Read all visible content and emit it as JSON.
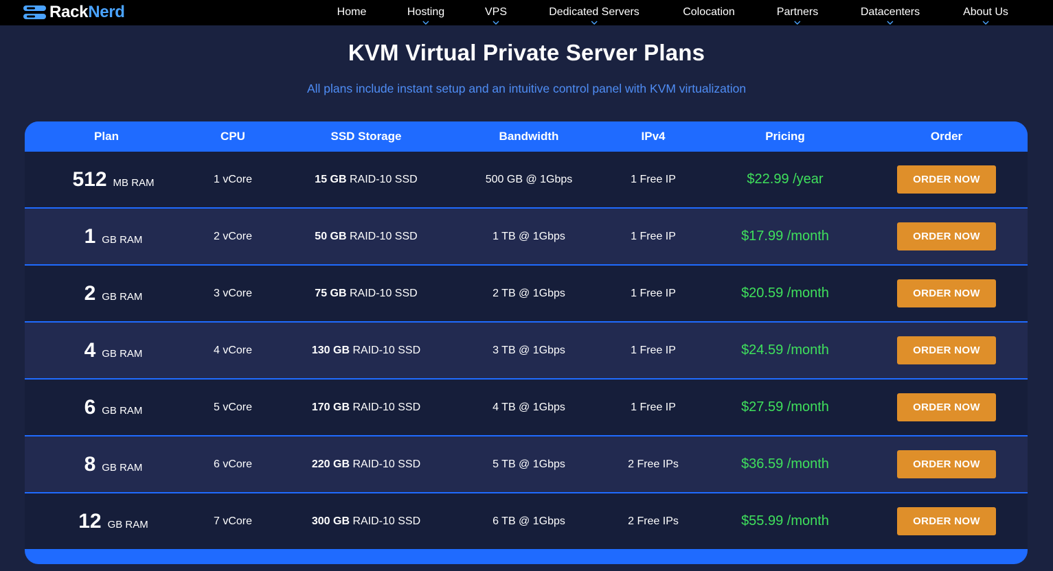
{
  "brand": {
    "name_part1": "Rack",
    "name_part2": "Nerd",
    "logo_icon": "server-stack-icon",
    "accent_color": "#4aa3ff"
  },
  "nav": {
    "items": [
      {
        "label": "Home",
        "has_dropdown": false
      },
      {
        "label": "Hosting",
        "has_dropdown": true
      },
      {
        "label": "VPS",
        "has_dropdown": true
      },
      {
        "label": "Dedicated Servers",
        "has_dropdown": true
      },
      {
        "label": "Colocation",
        "has_dropdown": false
      },
      {
        "label": "Partners",
        "has_dropdown": true
      },
      {
        "label": "Datacenters",
        "has_dropdown": true
      },
      {
        "label": "About Us",
        "has_dropdown": true
      }
    ],
    "dropdown_icon": "chevron-down-icon"
  },
  "section": {
    "title": "KVM Virtual Private Server Plans",
    "subtitle": "All plans include instant setup and an intuitive control panel with KVM virtualization"
  },
  "table": {
    "headers": [
      "Plan",
      "CPU",
      "SSD Storage",
      "Bandwidth",
      "IPv4",
      "Pricing",
      "Order"
    ],
    "rows": [
      {
        "plan_num": "512",
        "plan_unit": "MB RAM",
        "cpu": "1 vCore",
        "storage_size": "15 GB",
        "storage_type": "RAID-10 SSD",
        "bandwidth": "500 GB @ 1Gbps",
        "ipv4": "1 Free IP",
        "price": "$22.99 /year",
        "order": "ORDER NOW"
      },
      {
        "plan_num": "1",
        "plan_unit": "GB RAM",
        "cpu": "2 vCore",
        "storage_size": "50 GB",
        "storage_type": "RAID-10 SSD",
        "bandwidth": "1 TB @ 1Gbps",
        "ipv4": "1 Free IP",
        "price": "$17.99 /month",
        "order": "ORDER NOW"
      },
      {
        "plan_num": "2",
        "plan_unit": "GB RAM",
        "cpu": "3 vCore",
        "storage_size": "75 GB",
        "storage_type": "RAID-10 SSD",
        "bandwidth": "2 TB @ 1Gbps",
        "ipv4": "1 Free IP",
        "price": "$20.59 /month",
        "order": "ORDER NOW"
      },
      {
        "plan_num": "4",
        "plan_unit": "GB RAM",
        "cpu": "4 vCore",
        "storage_size": "130 GB",
        "storage_type": "RAID-10 SSD",
        "bandwidth": "3 TB @ 1Gbps",
        "ipv4": "1 Free IP",
        "price": "$24.59 /month",
        "order": "ORDER NOW"
      },
      {
        "plan_num": "6",
        "plan_unit": "GB RAM",
        "cpu": "5 vCore",
        "storage_size": "170 GB",
        "storage_type": "RAID-10 SSD",
        "bandwidth": "4 TB @ 1Gbps",
        "ipv4": "1 Free IP",
        "price": "$27.59 /month",
        "order": "ORDER NOW"
      },
      {
        "plan_num": "8",
        "plan_unit": "GB RAM",
        "cpu": "6 vCore",
        "storage_size": "220 GB",
        "storage_type": "RAID-10 SSD",
        "bandwidth": "5 TB @ 1Gbps",
        "ipv4": "2 Free IPs",
        "price": "$36.59 /month",
        "order": "ORDER NOW"
      },
      {
        "plan_num": "12",
        "plan_unit": "GB RAM",
        "cpu": "7 vCore",
        "storage_size": "300 GB",
        "storage_type": "RAID-10 SSD",
        "bandwidth": "6 TB @ 1Gbps",
        "ipv4": "2 Free IPs",
        "price": "$55.99 /month",
        "order": "ORDER NOW"
      }
    ]
  },
  "colors": {
    "page_bg": "#1a2240",
    "header_blue": "#1f6bff",
    "price_green": "#3fe05c",
    "order_orange": "#df8f2a",
    "subtitle_blue": "#4f8df5"
  }
}
